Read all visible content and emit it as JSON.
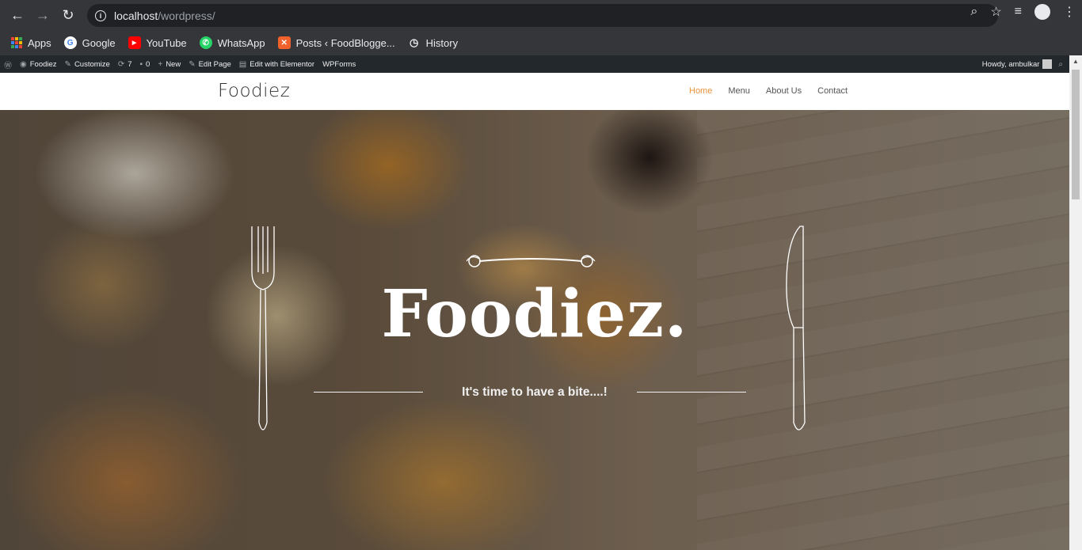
{
  "browser": {
    "url_host": "localhost",
    "url_path": "/wordpress/"
  },
  "bookmarks": [
    {
      "label": "Apps",
      "icon": "apps-grid-icon"
    },
    {
      "label": "Google",
      "icon": "google-icon"
    },
    {
      "label": "YouTube",
      "icon": "youtube-icon"
    },
    {
      "label": "WhatsApp",
      "icon": "whatsapp-icon"
    },
    {
      "label": "Posts ‹ FoodBlogge...",
      "icon": "xampp-icon"
    },
    {
      "label": "History",
      "icon": "history-icon"
    }
  ],
  "adminbar": {
    "site": "Foodiez",
    "customize": "Customize",
    "updates": "7",
    "comments": "0",
    "new": "New",
    "edit_page": "Edit Page",
    "edit_elementor": "Edit with Elementor",
    "wpforms": "WPForms",
    "howdy": "Howdy, ambulkar"
  },
  "site": {
    "title": "Foodiez",
    "menu": [
      "Home",
      "Menu",
      "About Us",
      "Contact"
    ]
  },
  "hero": {
    "title": "Foodiez.",
    "tagline": "It's time to have a bite....!"
  },
  "colors": {
    "accent": "#e8923a",
    "adminbar": "#23282d",
    "chrome": "#35363a"
  }
}
